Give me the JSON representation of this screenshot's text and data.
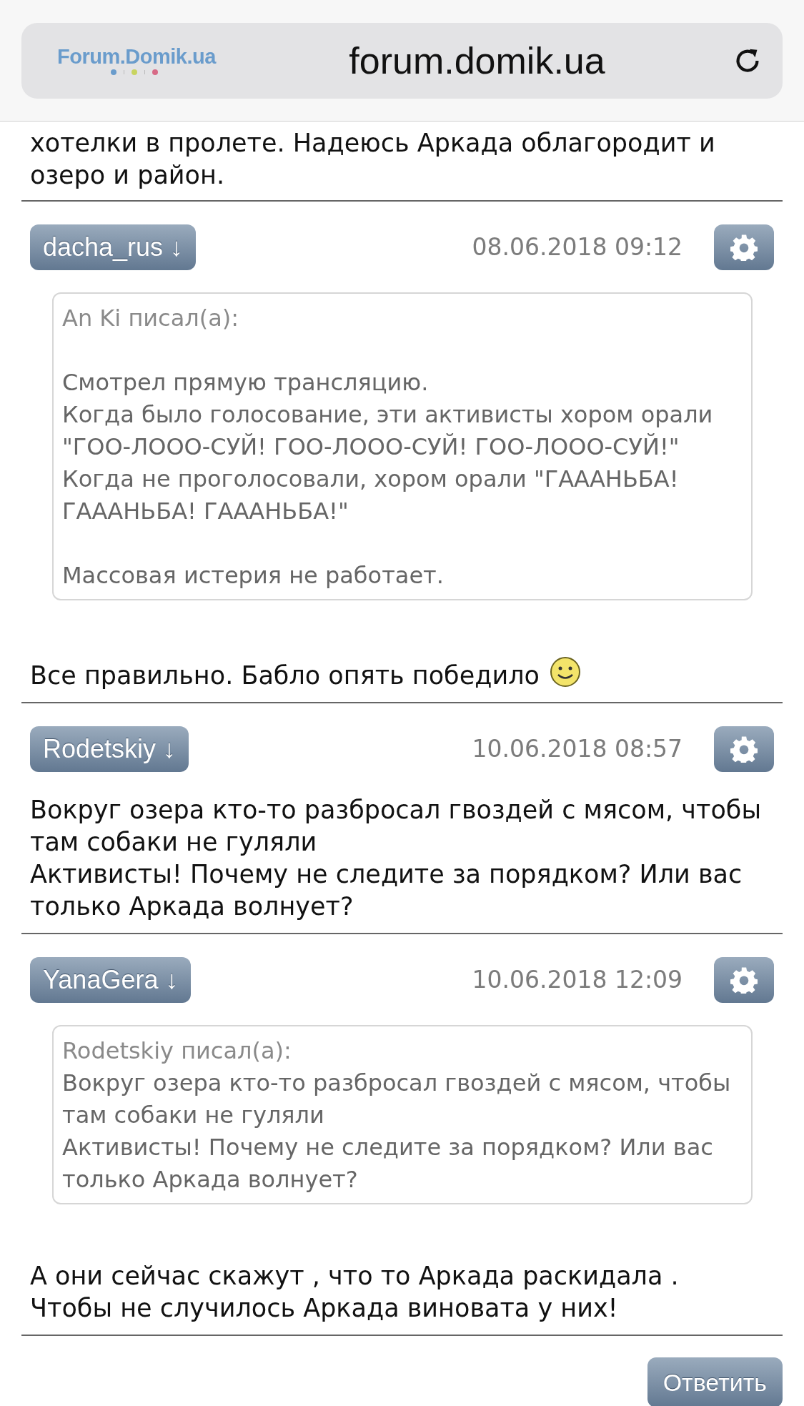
{
  "address_bar": {
    "logo": "Forum.Domik.ua",
    "url": "forum.domik.ua"
  },
  "intro_text": "хотелки в пролете. Надеюсь Аркада облагородит и\nозеро и район.",
  "posts": [
    {
      "author": "dacha_rus ↓",
      "date": "08.06.2018 09:12",
      "quote": {
        "header": "An Ki писал(а):",
        "spaced": true,
        "paragraphs": [
          "Смотрел прямую трансляцию.\nКогда было голосование, эти активисты хором орали\n\"ГОО-ЛООО-СУЙ! ГОО-ЛООО-СУЙ! ГОО-ЛООО-СУЙ!\"\nКогда не проголосовали, хором орали \"ГАААНЬБА!\nГАААНЬБА! ГАААНЬБА!\"",
          "Массовая истерия не работает."
        ]
      },
      "text": "Все правильно. Бабло опять победило",
      "smiley": true
    },
    {
      "author": "Rodetskiy ↓",
      "date": "10.06.2018 08:57",
      "text": "Вокруг озера кто-то разбросал гвоздей с мясом, чтобы\nтам собаки не гуляли\nАктивисты! Почему не следите за порядком? Или вас\nтолько Аркада волнует?",
      "smiley": false
    },
    {
      "author": "YanaGera ↓",
      "date": "10.06.2018 12:09",
      "quote": {
        "header": "Rodetskiy писал(а):",
        "spaced": false,
        "paragraphs": [
          "Вокруг озера кто-то разбросал гвоздей с мясом, чтобы\nтам собаки не гуляли\nАктивисты! Почему не следите за порядком? Или вас\nтолько Аркада волнует?"
        ]
      },
      "text": "А они сейчас скажут , что то Аркада раскидала .\nЧтобы не случилось Аркада виновата у них!",
      "smiley": false
    }
  ],
  "reply_button": "Ответить"
}
